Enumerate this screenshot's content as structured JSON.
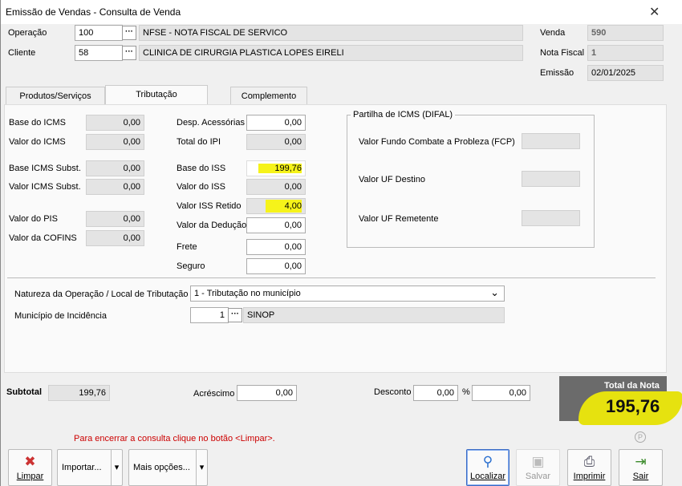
{
  "window": {
    "title": "Emissão de Vendas - Consulta de Venda",
    "close": "✕"
  },
  "header": {
    "operacao_label": "Operação",
    "operacao_code": "100",
    "operacao_desc": "NFSE - NOTA FISCAL DE SERVICO",
    "cliente_label": "Cliente",
    "cliente_code": "58",
    "cliente_desc": "CLINICA DE CIRURGIA PLASTICA LOPES EIRELI",
    "venda_label": "Venda",
    "venda_value": "590",
    "nota_label": "Nota Fiscal",
    "nota_value": "1",
    "emissao_label": "Emissão",
    "emissao_value": "02/01/2025",
    "lookup": "···"
  },
  "tabs": [
    {
      "label": "Produtos/Serviços"
    },
    {
      "label": "Tributação"
    },
    {
      "label": "Complemento"
    }
  ],
  "col1": {
    "base_icms": {
      "label": "Base do ICMS",
      "value": "0,00"
    },
    "valor_icms": {
      "label": "Valor do ICMS",
      "value": "0,00"
    },
    "base_icms_subst": {
      "label": "Base ICMS Subst.",
      "value": "0,00"
    },
    "valor_icms_subst": {
      "label": "Valor ICMS Subst.",
      "value": "0,00"
    },
    "valor_pis": {
      "label": "Valor do PIS",
      "value": "0,00"
    },
    "valor_cofins": {
      "label": "Valor da COFINS",
      "value": "0,00"
    }
  },
  "col2": {
    "desp_acessorias": {
      "label": "Desp. Acessórias",
      "value": "0,00"
    },
    "total_ipi": {
      "label": "Total do IPI",
      "value": "0,00"
    },
    "base_iss": {
      "label": "Base do ISS",
      "value": "199,76"
    },
    "valor_iss": {
      "label": "Valor do ISS",
      "value": "0,00"
    },
    "valor_iss_retido": {
      "label": "Valor ISS Retido",
      "value": "4,00"
    },
    "valor_deducao": {
      "label": "Valor da Dedução",
      "value": "0,00"
    },
    "frete": {
      "label": "Frete",
      "value": "0,00"
    },
    "seguro": {
      "label": "Seguro",
      "value": "0,00"
    }
  },
  "difal": {
    "title": "Partilha de ICMS (DIFAL)",
    "fcp_label": "Valor Fundo Combate a Probleza (FCP)",
    "uf_destino_label": "Valor UF Destino",
    "uf_remetente_label": "Valor UF Remetente"
  },
  "natureza": {
    "label": "Natureza da Operação / Local de Tributação",
    "value": "1 - Tributação no município",
    "chevron": "⌄"
  },
  "municipio": {
    "label": "Município de Incidência",
    "code": "1",
    "name": "SINOP"
  },
  "totals": {
    "subtotal_label": "Subtotal",
    "subtotal_value": "199,76",
    "acrescimo_label": "Acréscimo",
    "acrescimo_value": "0,00",
    "desconto_label": "Desconto",
    "desconto_value": "0,00",
    "percent_sign": "%",
    "desconto_pct": "0,00",
    "total_label": "Total da Nota",
    "total_value": "195,76"
  },
  "footer": {
    "message": "Para encerrar a consulta clique no botão <Limpar>.",
    "p_symbol": "P",
    "buttons": {
      "limpar": "Limpar",
      "importar": "Importar...",
      "mais": "Mais opções...",
      "localizar": "Localizar",
      "salvar": "Salvar",
      "imprimir": "Imprimir",
      "sair": "Sair"
    },
    "dropdown_arrow": "▾"
  },
  "colors": {
    "highlight": "#f6f31a",
    "total_bg": "#6b6b6b",
    "message": "#cc0000"
  }
}
